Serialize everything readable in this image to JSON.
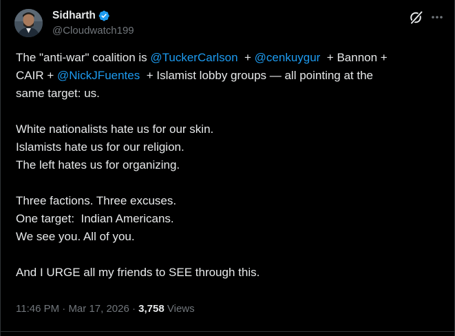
{
  "author": {
    "display_name": "Sidharth",
    "handle": "@Cloudwatch199",
    "verified": true
  },
  "tweet": {
    "lines": [
      [
        {
          "text": "The \"anti-war\" coalition is ",
          "type": "text"
        },
        {
          "text": "@TuckerCarlson",
          "type": "mention"
        },
        {
          "text": "  + ",
          "type": "text"
        },
        {
          "text": "@cenkuygur",
          "type": "mention"
        },
        {
          "text": "  + Bannon +",
          "type": "text"
        }
      ],
      [
        {
          "text": "CAIR + ",
          "type": "text"
        },
        {
          "text": "@NickJFuentes",
          "type": "mention"
        },
        {
          "text": "  + Islamist lobby groups — all pointing at the",
          "type": "text"
        }
      ],
      [
        {
          "text": "same target: us.",
          "type": "text"
        }
      ],
      [],
      [
        {
          "text": "White nationalists hate us for our skin.",
          "type": "text"
        }
      ],
      [
        {
          "text": "Islamists hate us for our religion.",
          "type": "text"
        }
      ],
      [
        {
          "text": "The left hates us for organizing.",
          "type": "text"
        }
      ],
      [],
      [
        {
          "text": "Three factions. Three excuses.",
          "type": "text"
        }
      ],
      [
        {
          "text": "One target:  Indian Americans.",
          "type": "text"
        }
      ],
      [
        {
          "text": "We see you. All of you.",
          "type": "text"
        }
      ],
      [],
      [
        {
          "text": "And I URGE all my friends to SEE through this.",
          "type": "text"
        }
      ]
    ]
  },
  "meta": {
    "time": "11:46 PM",
    "separator": " · ",
    "date": "Mar 17, 2026",
    "views_count": "3,758",
    "views_label": " Views"
  },
  "icons": {
    "verified": "verified-badge-icon",
    "grok": "grok-icon",
    "more": "more-icon"
  },
  "colors": {
    "background": "#000000",
    "text": "#e7e9ea",
    "secondary": "#71767b",
    "accent": "#1d9bf0"
  }
}
